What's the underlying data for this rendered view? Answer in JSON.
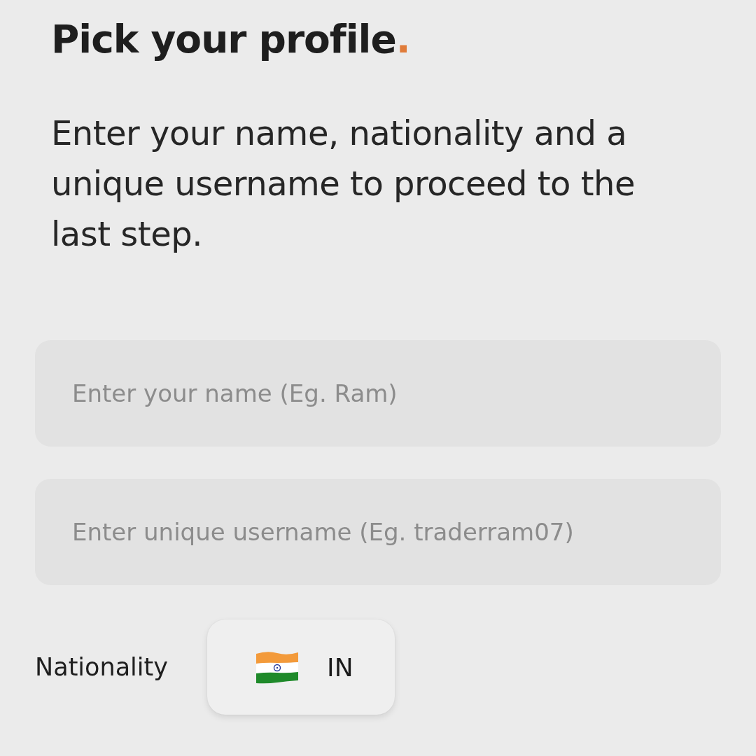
{
  "title": {
    "text": "Pick your profile",
    "accent": "."
  },
  "description": "Enter your name, nationality and a unique username to proceed to the last step.",
  "fields": [
    {
      "placeholder": "Enter your name (Eg. Ram)"
    },
    {
      "placeholder": "Enter unique username (Eg. traderram07)"
    }
  ],
  "nationality": {
    "label": "Nationality",
    "country_code": "IN"
  }
}
